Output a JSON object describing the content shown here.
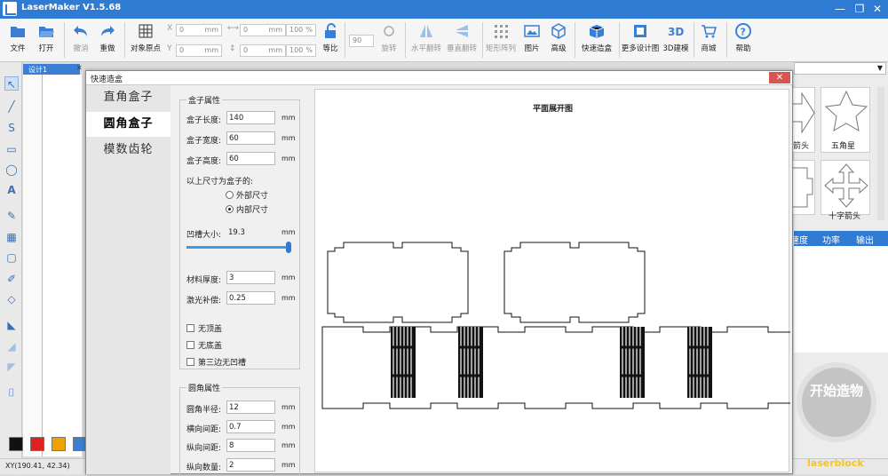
{
  "app": {
    "title": "LaserMaker V1.5.68"
  },
  "window_controls": {
    "minimize": "—",
    "restore": "❐",
    "close": "✕"
  },
  "ribbon": {
    "file": "文件",
    "open": "打开",
    "undo": "撤消",
    "redo": "重做",
    "object_origin": "对象原点",
    "x_value": "0",
    "y_value": "0",
    "w_value": "0",
    "h_value": "0",
    "w_percent": "100",
    "h_percent": "100",
    "unit_mm": "mm",
    "unit_pct": "%",
    "scale_lock": "等比",
    "rotate_value": "90",
    "rotate": "旋转",
    "hflip": "水平翻转",
    "vflip": "垂直翻转",
    "array": "矩形阵列",
    "image": "图片",
    "advanced": "高级",
    "quick_box": "快速造盒",
    "more_designs": "更多设计图",
    "model_3d": "3D建模",
    "shop": "商城",
    "help": "帮助"
  },
  "document": {
    "tab": "设计1"
  },
  "status": {
    "xy": "XY(190.41, 42.34)"
  },
  "colors": {
    "palette": [
      "#111111",
      "#e02020",
      "#f0a000",
      "#3b7fd4"
    ],
    "accent": "#2f7bd3"
  },
  "right_panel": {
    "shape_a": "箭头",
    "shape_b": "五角星",
    "shape_c": "十字箭头",
    "table_headers": [
      "速度",
      "功率",
      "输出"
    ],
    "start_button": "开始造物",
    "watermark": "laserblock"
  },
  "dialog": {
    "title": "快速造盒",
    "close": "✕",
    "nav": [
      "直角盒子",
      "圆角盒子",
      "模数齿轮"
    ],
    "box_group": "盒子属性",
    "length_label": "盒子长度:",
    "length": "140",
    "width_label": "盒子宽度:",
    "width": "60",
    "height_label": "盒子高度:",
    "height": "60",
    "unit": "mm",
    "dims_label": "以上尺寸为盒子的:",
    "outer": "外部尺寸",
    "inner": "内部尺寸",
    "notch_label": "凹槽大小:",
    "notch": "19.3",
    "notch_slider": 1.0,
    "thickness_label": "材料厚度:",
    "thickness": "3",
    "kerf_label": "激光补偿:",
    "kerf": "0.25",
    "no_top": "无顶盖",
    "no_bottom": "无底盖",
    "no_third_notch": "第三边无凹槽",
    "corner_group": "圆角属性",
    "radius_label": "圆角半径:",
    "radius": "12",
    "hgap_label": "横向间距:",
    "hgap": "0.7",
    "vgap_label": "纵向间距:",
    "vgap": "8",
    "vcount_label": "纵向数量:",
    "vcount": "2",
    "preview_title": "平面展开图"
  }
}
